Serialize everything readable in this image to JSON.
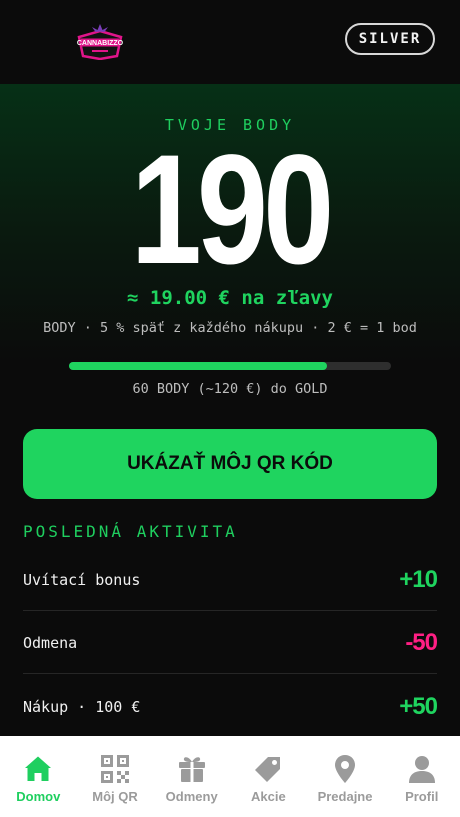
{
  "header": {
    "logo_text": "CANNABIZZO",
    "tier": "SILVER"
  },
  "hero": {
    "label": "TVOJE BODY",
    "points": "190",
    "discount": "≈ 19.00 € na zľavy",
    "rule": "BODY · 5 % späť z každého nákupu · 2 € = 1 bod",
    "progress_fraction": 0.8,
    "progress_label": "60 BODY (~120 €) do GOLD"
  },
  "qr_button": "UKÁZAŤ MÔJ QR KÓD",
  "activity": {
    "title": "POSLEDNÁ AKTIVITA",
    "items": [
      {
        "label": "Uvítací bonus",
        "value": "+10"
      },
      {
        "label": "Odmena",
        "value": "-50"
      },
      {
        "label": "Nákup · 100 €",
        "value": "+50"
      }
    ]
  },
  "nav": [
    {
      "label": "Domov",
      "icon": "home-icon"
    },
    {
      "label": "Môj QR",
      "icon": "qr-code-icon"
    },
    {
      "label": "Odmeny",
      "icon": "gift-icon"
    },
    {
      "label": "Akcie",
      "icon": "tag-icon"
    },
    {
      "label": "Predajne",
      "icon": "location-pin-icon"
    },
    {
      "label": "Profil",
      "icon": "user-icon"
    }
  ],
  "colors": {
    "accent": "#1fd45f",
    "negative": "#ff1f84",
    "background": "#0b0b0b",
    "logo": "#e0148a"
  }
}
